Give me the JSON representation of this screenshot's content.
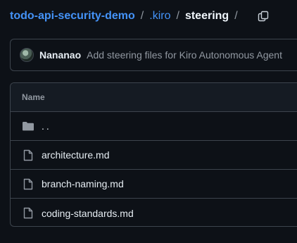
{
  "breadcrumb": {
    "repo": "todo-api-security-demo",
    "separator": "/",
    "folder": ".kiro",
    "current": "steering"
  },
  "commit": {
    "author": "Nananao",
    "message": "Add steering files for Kiro Autonomous Agent"
  },
  "table": {
    "header": "Name",
    "parent_dir": "..",
    "files": [
      {
        "name": "architecture.md",
        "icon": "file-icon"
      },
      {
        "name": "branch-naming.md",
        "icon": "file-icon"
      },
      {
        "name": "coding-standards.md",
        "icon": "file-icon"
      }
    ]
  },
  "colors": {
    "background": "#0d1117",
    "link": "#4493f8",
    "border": "#3d444d",
    "muted": "#9198a1"
  }
}
